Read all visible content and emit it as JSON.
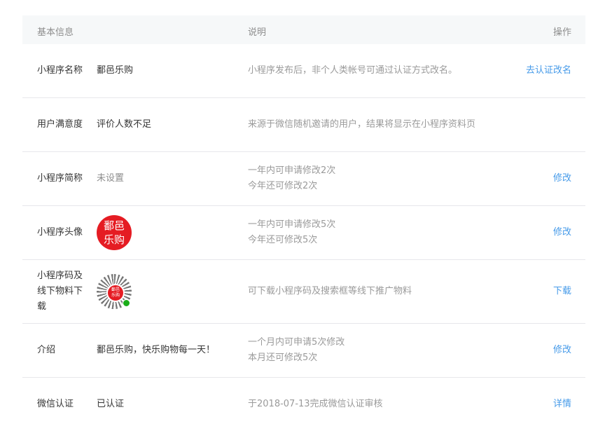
{
  "header": {
    "col_basic": "基本信息",
    "col_desc": "说明",
    "col_action": "操作"
  },
  "rows": [
    {
      "label": "小程序名称",
      "value": "鄱邑乐购",
      "desc": "小程序发布后，非个人类帐号可通过认证方式改名。",
      "action": "去认证改名"
    },
    {
      "label": "用户满意度",
      "value": "评价人数不足",
      "desc": "来源于微信随机邀请的用户，结果将显示在小程序资料页",
      "action": ""
    },
    {
      "label": "小程序简称",
      "value": "未设置",
      "desc_line1": "一年内可申请修改2次",
      "desc_line2": "今年还可修改2次",
      "action": "修改"
    },
    {
      "label": "小程序头像",
      "avatar_text1": "鄱邑",
      "avatar_text2": "乐购",
      "desc_line1": "一年内可申请修改5次",
      "desc_line2": "今年还可修改5次",
      "action": "修改"
    },
    {
      "label": "小程序码及线下物料下载",
      "qr_text1": "鄱邑",
      "qr_text2": "乐购",
      "desc": "可下载小程序码及搜索框等线下推广物料",
      "action": "下载"
    },
    {
      "label": "介绍",
      "value": "鄱邑乐购，快乐购物每一天！",
      "desc_line1": "一个月内可申请5次修改",
      "desc_line2": "本月还可修改5次",
      "action": "修改"
    },
    {
      "label": "微信认证",
      "value": "已认证",
      "desc": "于2018-07-13完成微信认证审核",
      "action": "详情"
    }
  ],
  "colors": {
    "link": "#459ae9",
    "avatar_bg": "#e51c23",
    "header_bg": "#f6f8f9"
  }
}
